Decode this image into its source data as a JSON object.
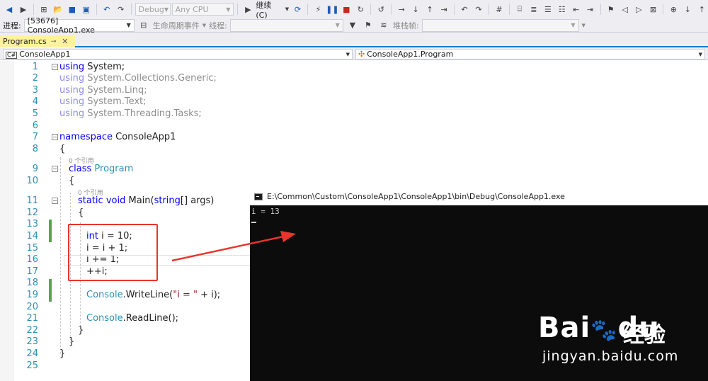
{
  "toolbar": {
    "config_combo": "Debug",
    "platform_combo": "Any CPU",
    "continue_label": "继续(C)",
    "process_label": "进程:",
    "process_value": "[53676] ConsoleApp1.exe",
    "lifecycle_label": "生命周期事件",
    "thread_label": "线程:",
    "stackframe_label": "堆栈帧:"
  },
  "tab": {
    "label": "Program.cs"
  },
  "navbar": {
    "project": "ConsoleApp1",
    "class": "ConsoleApp1.Program"
  },
  "editor": {
    "references_label": "0 个引用",
    "lines": [
      {
        "n": "1"
      },
      {
        "n": "2"
      },
      {
        "n": "3"
      },
      {
        "n": "4"
      },
      {
        "n": "5"
      },
      {
        "n": "6"
      },
      {
        "n": "7"
      },
      {
        "n": "8"
      },
      {
        "n": "9"
      },
      {
        "n": "10"
      },
      {
        "n": "11"
      },
      {
        "n": "12"
      },
      {
        "n": "13"
      },
      {
        "n": "14"
      },
      {
        "n": "15"
      },
      {
        "n": "16"
      },
      {
        "n": "17"
      },
      {
        "n": "18"
      },
      {
        "n": "19"
      },
      {
        "n": "20"
      },
      {
        "n": "21"
      },
      {
        "n": "22"
      },
      {
        "n": "23"
      },
      {
        "n": "24"
      },
      {
        "n": "25"
      }
    ],
    "code": {
      "l1_kw": "using",
      "l1_rest": " System;",
      "l2_kw": "using",
      "l2_rest": " System.Collections.Generic;",
      "l3_kw": "using",
      "l3_rest": " System.Linq;",
      "l4_kw": "using",
      "l4_rest": " System.Text;",
      "l5_kw": "using",
      "l5_rest": " System.Threading.Tasks;",
      "l7_kw": "namespace",
      "l7_rest": " ConsoleApp1",
      "l8": "{",
      "l9_kw": "class",
      "l9_type": " Program",
      "l10": "{",
      "l11_kw": "static void",
      "l11_name": " Main(",
      "l11_type": "string",
      "l11_rest": "[] args)",
      "l12": "{",
      "l14_kw": "int",
      "l14_rest": " i = 10;",
      "l15": "i = i + 1;",
      "l16": "i += 1;",
      "l17": "++i;",
      "l19_type": "Console",
      "l19_a": ".WriteLine(",
      "l19_str": "\"i = \"",
      "l19_b": " + i);",
      "l21_type": "Console",
      "l21_a": ".ReadLine();",
      "l22": "}",
      "l23": "}",
      "l24": "}"
    }
  },
  "console": {
    "title": "E:\\Common\\Custom\\ConsoleApp1\\ConsoleApp1\\bin\\Debug\\ConsoleApp1.exe",
    "output": "i = 13"
  },
  "watermark": {
    "logo": "Bai",
    "logo_end": "du",
    "cn": "经验",
    "url": "jingyan.baidu.com"
  },
  "colors": {
    "accent": "#007acc",
    "highlight_box": "#e8352e",
    "keyword": "#0000ff",
    "type": "#2b91af",
    "string": "#a31515"
  }
}
